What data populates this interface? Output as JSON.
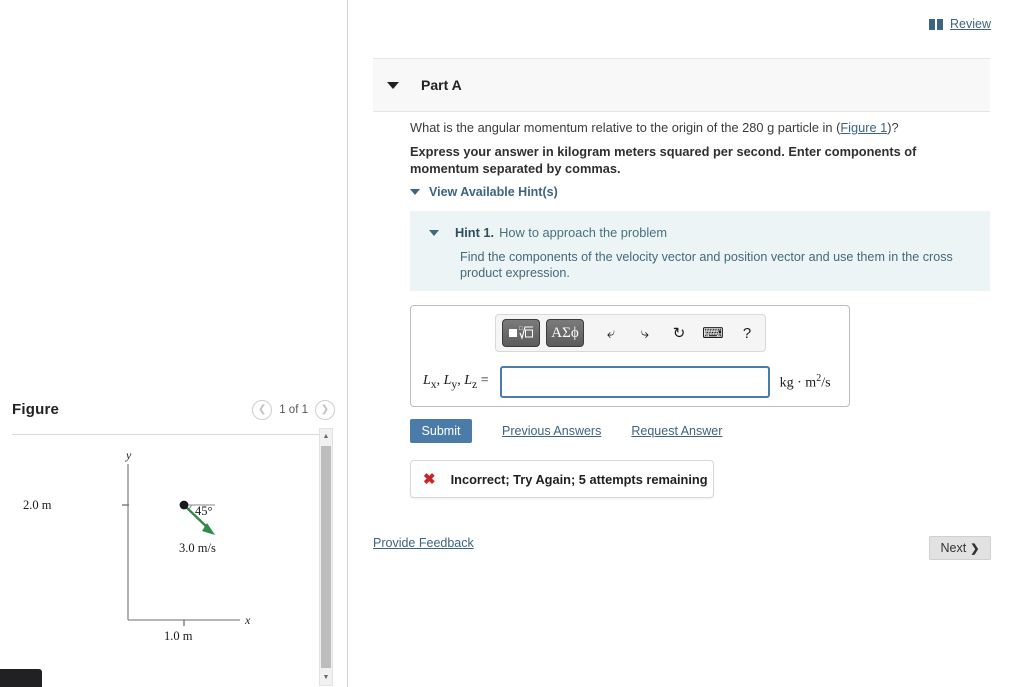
{
  "header": {
    "review_label": "Review",
    "review_icon": "book-icon"
  },
  "part": {
    "title": "Part A",
    "caret_icon": "caret-down-icon"
  },
  "question": {
    "text_before_link": "What is the angular momentum relative to the origin of the 280 g particle in (",
    "link_label": "Figure 1",
    "text_after_link": ")?",
    "instruction": "Express your answer in kilogram meters squared per second. Enter components of momentum separated by commas."
  },
  "hints": {
    "toggle_label": "View Available Hint(s)",
    "toggle_icon": "caret-down-icon",
    "hint": {
      "caret_icon": "caret-down-icon",
      "number_label": "Hint 1.",
      "title": "How to approach the problem",
      "body": "Find the components of the velocity vector and position vector and use them in the cross product expression."
    }
  },
  "answer": {
    "toolbar": {
      "buttons": [
        {
          "name": "math-template-button",
          "label": "■√□",
          "icon": "square-root-template-icon"
        },
        {
          "name": "greek-symbols-button",
          "label": "ΑΣϕ",
          "icon": "greek-letters-icon"
        }
      ],
      "icons": [
        {
          "name": "undo-button",
          "label": "↶",
          "icon": "undo-arrow-icon"
        },
        {
          "name": "redo-button",
          "label": "↷",
          "icon": "redo-arrow-icon"
        },
        {
          "name": "reset-button",
          "label": "↻",
          "icon": "refresh-circle-icon"
        },
        {
          "name": "keyboard-button",
          "label": "⌨",
          "icon": "keyboard-icon"
        },
        {
          "name": "help-button",
          "label": "?",
          "icon": "question-mark-icon"
        }
      ]
    },
    "field_label": "Lₓ, Lᵧ, Lₓ =",
    "field_label_parts": {
      "lx": "L",
      "x": "x",
      "ly": "L",
      "y": "y",
      "lz": "L",
      "z": "z",
      "equals": "="
    },
    "input_value": "",
    "input_placeholder": "",
    "units_base": "kg · m",
    "units_exponent": "2",
    "units_suffix": "/s"
  },
  "actions": {
    "submit_label": "Submit",
    "previous_answers_label": "Previous Answers",
    "request_answer_label": "Request Answer"
  },
  "feedback": {
    "icon": "x-mark-icon",
    "message": "Incorrect; Try Again; 5 attempts remaining",
    "color": "#c62626"
  },
  "footer": {
    "provide_feedback_label": "Provide Feedback",
    "next_label": "Next",
    "next_icon": "chevron-right-icon"
  },
  "figure_panel": {
    "title": "Figure",
    "counter": "1 of 1",
    "prev_icon": "chevron-left-icon",
    "next_icon": "chevron-right-icon",
    "scroll_up_icon": "triangle-up-icon",
    "scroll_down_icon": "triangle-down-icon"
  },
  "figure": {
    "axis_x_label": "x",
    "axis_y_label": "y",
    "y_tick_label": "2.0 m",
    "x_tick_label": "1.0 m",
    "angle_label": "45°",
    "velocity_label": "3.0 m/s",
    "particle_color": "#1a1a1a",
    "vector_color": "#2e8b45",
    "axis_color": "#8a8a8a"
  },
  "colors": {
    "link": "#3d6480",
    "submit": "#4b7ba8",
    "hint_bg": "#edf4f5",
    "part_header_bg": "#f8f8f8",
    "error": "#c62626"
  }
}
